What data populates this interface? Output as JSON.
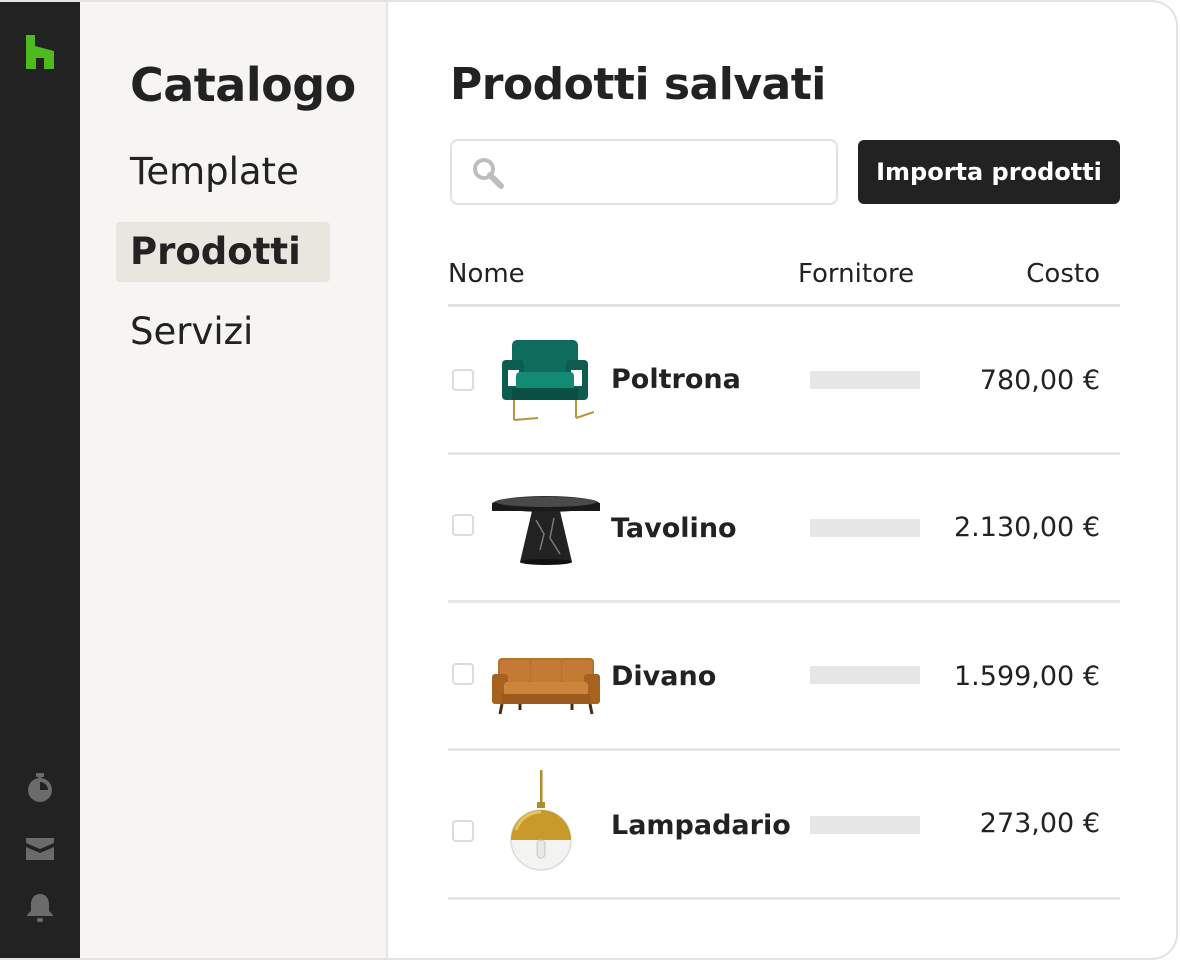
{
  "rail": {
    "logo_icon": "houzz-logo-icon",
    "logo_color": "#4dbb20",
    "icons": [
      "timer-icon",
      "inbox-icon",
      "bell-icon"
    ]
  },
  "sidebar": {
    "title": "Catalogo",
    "items": [
      {
        "label": "Template",
        "active": false
      },
      {
        "label": "Prodotti",
        "active": true
      },
      {
        "label": "Servizi",
        "active": false
      }
    ]
  },
  "main": {
    "title": "Prodotti salvati",
    "search": {
      "placeholder": "",
      "value": "",
      "icon": "search-icon"
    },
    "import_button": "Importa prodotti",
    "columns": {
      "name": "Nome",
      "supplier": "Fornitore",
      "cost": "Costo"
    },
    "rows": [
      {
        "name": "Poltrona",
        "cost": "780,00 €",
        "thumb": "armchair-image",
        "checked": false
      },
      {
        "name": "Tavolino",
        "cost": "2.130,00 €",
        "thumb": "table-image",
        "checked": false
      },
      {
        "name": "Divano",
        "cost": "1.599,00 €",
        "thumb": "sofa-image",
        "checked": false
      },
      {
        "name": "Lampadario",
        "cost": "273,00 €",
        "thumb": "pendant-lamp-image",
        "checked": false
      }
    ]
  }
}
